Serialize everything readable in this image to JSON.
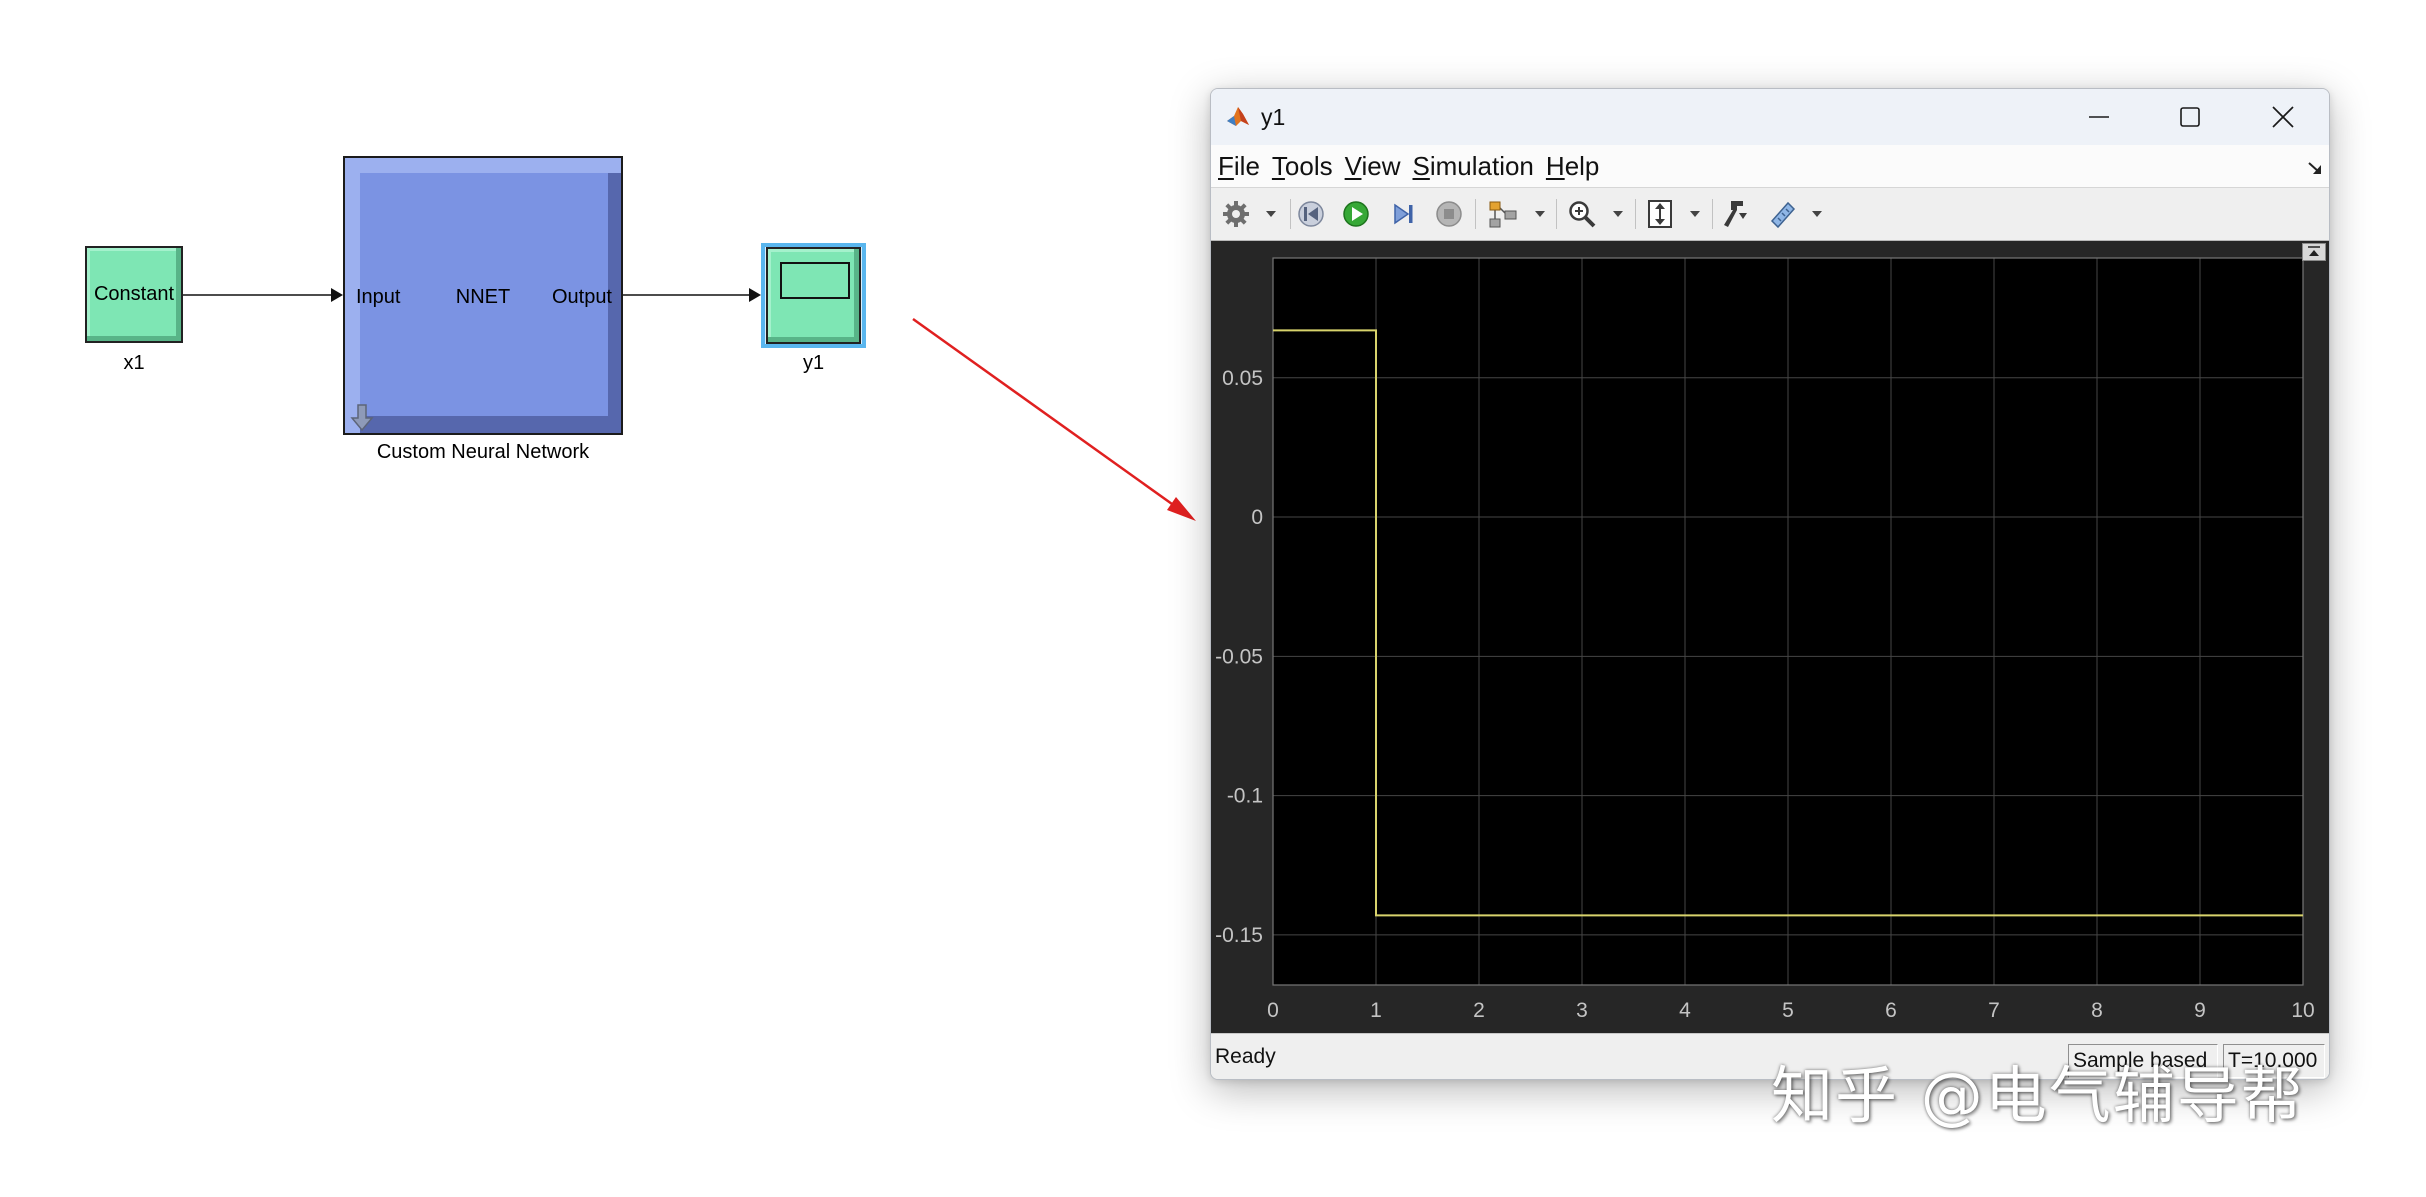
{
  "model": {
    "constant_block": {
      "text": "Constant",
      "name": "x1",
      "color": "#7ee6b4"
    },
    "nnet_block": {
      "input_port": "Input",
      "title": "NNET",
      "output_port": "Output",
      "name": "Custom Neural Network",
      "color": "#7b93e3",
      "icon": "subsystem-arrow-icon"
    },
    "scope_block": {
      "name": "y1",
      "color": "#7ee6b4",
      "selected": true,
      "icon": "scope-display-icon"
    }
  },
  "annotation": {
    "arrow_color": "#e02020"
  },
  "scope_window": {
    "title": "y1",
    "app_icon": "matlab-icon",
    "window_controls": [
      "minimize-icon",
      "maximize-icon",
      "close-icon"
    ],
    "menu": [
      {
        "label": "File"
      },
      {
        "label": "Tools"
      },
      {
        "label": "View"
      },
      {
        "label": "Simulation"
      },
      {
        "label": "Help"
      }
    ],
    "menu_right_icon": "undock-icon",
    "toolbar": [
      "gear-icon",
      "step-back-icon",
      "run-icon",
      "step-forward-icon",
      "stop-icon",
      "signal-routing-icon",
      "zoom-in-icon",
      "scale-axes-icon",
      "highlight-block-icon",
      "measurements-icon"
    ],
    "status": {
      "message": "Ready",
      "mode": "Sample based",
      "time": "T=10.000"
    }
  },
  "chart_data": {
    "type": "line",
    "xlim": [
      0,
      10
    ],
    "ylim": [
      -0.168,
      0.093
    ],
    "xticks": [
      0,
      1,
      2,
      3,
      4,
      5,
      6,
      7,
      8,
      9,
      10
    ],
    "xtick_labels": [
      "0",
      "1",
      "2",
      "3",
      "4",
      "5",
      "6",
      "7",
      "8",
      "9",
      "10"
    ],
    "yticks": [
      0.05,
      0,
      -0.05,
      -0.1,
      -0.15
    ],
    "ytick_labels": [
      "0.05",
      "0",
      "-0.05",
      "-0.1",
      "-0.15"
    ],
    "grid": true,
    "axes_color": "#000000",
    "figure_color": "#262626",
    "grid_color": "#464646",
    "axes_edge_color": "#777777",
    "tick_label_color": "#c4c4c4",
    "series": [
      {
        "x": [
          0,
          1,
          1,
          10
        ],
        "y": [
          0.067,
          0.067,
          -0.143,
          -0.143
        ],
        "color": "#d8d36c"
      }
    ]
  },
  "watermark": "知乎 @电气辅导帮"
}
